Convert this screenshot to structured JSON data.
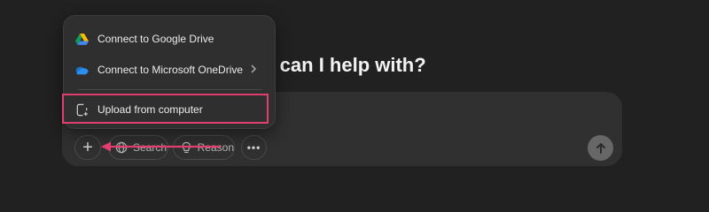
{
  "main": {
    "headline": "at can I help with?"
  },
  "menu": {
    "items": [
      {
        "label": "Connect to Google Drive",
        "icon": "google-drive-icon"
      },
      {
        "label": "Connect to Microsoft OneDrive",
        "icon": "onedrive-icon",
        "has_submenu": true
      },
      {
        "label": "Upload from computer",
        "icon": "upload-file-icon",
        "highlighted": true
      }
    ]
  },
  "toolbar": {
    "plus_label": "+",
    "search_label": "Search",
    "reason_label": "Reason",
    "more_label": "•••"
  },
  "colors": {
    "background": "#212121",
    "composer": "#303030",
    "highlight": "#e03e6e"
  }
}
